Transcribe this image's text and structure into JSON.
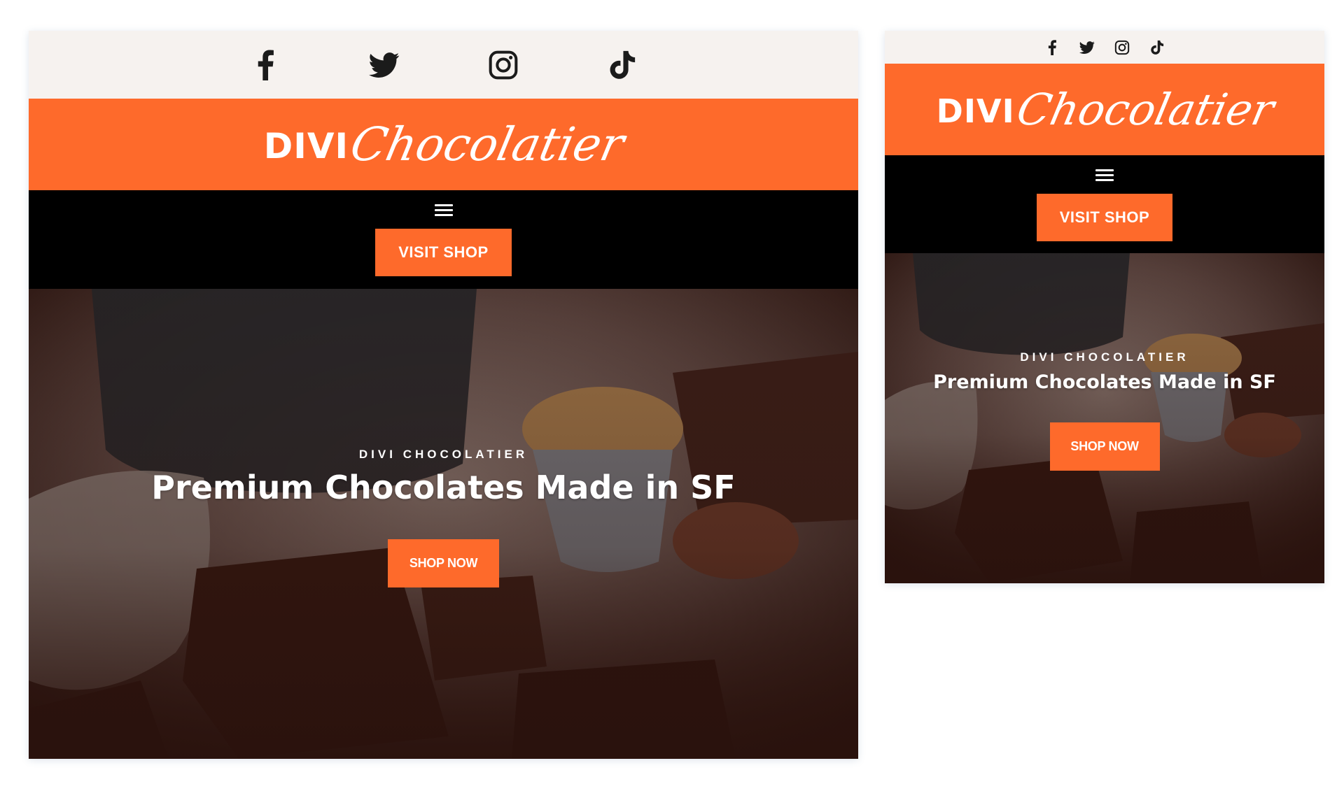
{
  "colors": {
    "orange": "#fe6a2b",
    "nav_background": "#000000",
    "social_background": "#f6f2ef",
    "icon_color": "#1b1b1b",
    "hero_dark": "#2a120d"
  },
  "social_icons": [
    "facebook-icon",
    "twitter-icon",
    "instagram-icon",
    "tiktok-icon"
  ],
  "logo": {
    "word1": "DIVI",
    "word2": "Chocolatier"
  },
  "nav": {
    "menu_icon": "hamburger-menu-icon",
    "visit_shop_label": "VISIT SHOP"
  },
  "hero": {
    "eyebrow": "DIVI CHOCOLATIER",
    "headline": "Premium Chocolates Made in SF",
    "cta_label": "SHOP NOW"
  }
}
